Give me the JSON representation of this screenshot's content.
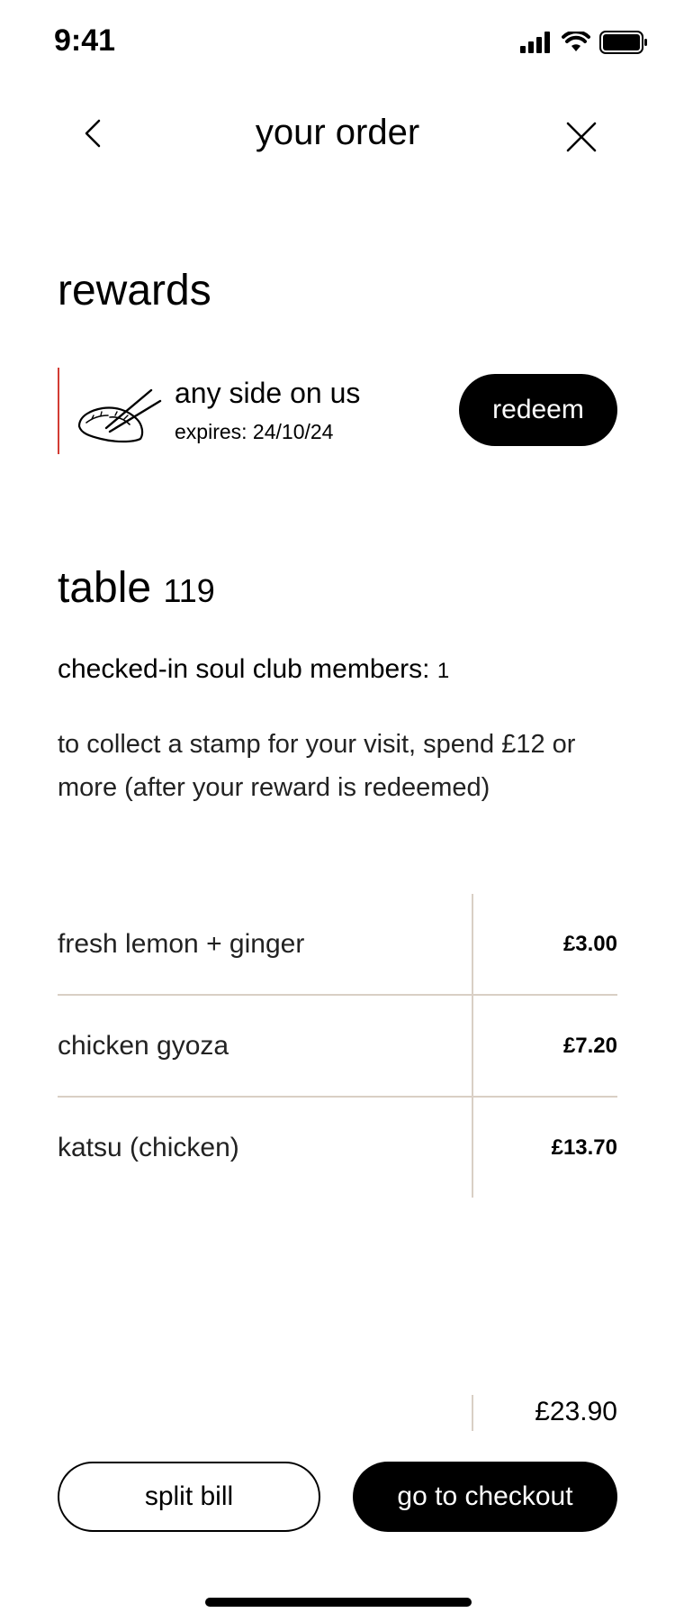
{
  "status_bar": {
    "time": "9:41",
    "icons": [
      "cellular-signal-icon",
      "wifi-icon",
      "battery-icon"
    ]
  },
  "header": {
    "title": "your order",
    "back_icon": "chevron-left-icon",
    "close_icon": "close-icon"
  },
  "rewards": {
    "title": "rewards",
    "reward": {
      "name": "any side on us",
      "expiry": "expires: 24/10/24",
      "icon": "gyoza-chopsticks-icon",
      "redeem_label": "redeem",
      "accent_color": "#d23c34"
    }
  },
  "table": {
    "label": "table",
    "number": "119",
    "members_label": "checked-in soul club members:",
    "members_count": "1",
    "stamp_info": "to collect a stamp for your visit, spend £12 or more (after your reward is redeemed)"
  },
  "order": {
    "items": [
      {
        "name": "fresh lemon + ginger",
        "price": "£3.00"
      },
      {
        "name": "chicken gyoza",
        "price": "£7.20"
      },
      {
        "name": "katsu (chicken)",
        "price": "£13.70"
      }
    ],
    "total": "£23.90"
  },
  "actions": {
    "split_label": "split bill",
    "checkout_label": "go to checkout"
  }
}
